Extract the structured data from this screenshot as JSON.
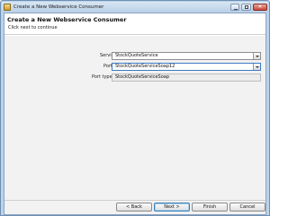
{
  "window": {
    "title": "Create a New Webservice Consumer"
  },
  "header": {
    "title": "Create a New Webservice Consumer",
    "subtitle": "Click next to continue"
  },
  "form": {
    "service": {
      "label": "Service",
      "value": "StockQuoteService"
    },
    "port": {
      "label": "Port",
      "value": "StockQuoteServiceSoap12"
    },
    "port_type": {
      "label": "Port type",
      "value": "StockQuoteServiceSoap"
    }
  },
  "footer": {
    "back_label": "< Back",
    "next_label": "Next >",
    "finish_label": "Finish",
    "cancel_label": "Cancel"
  }
}
